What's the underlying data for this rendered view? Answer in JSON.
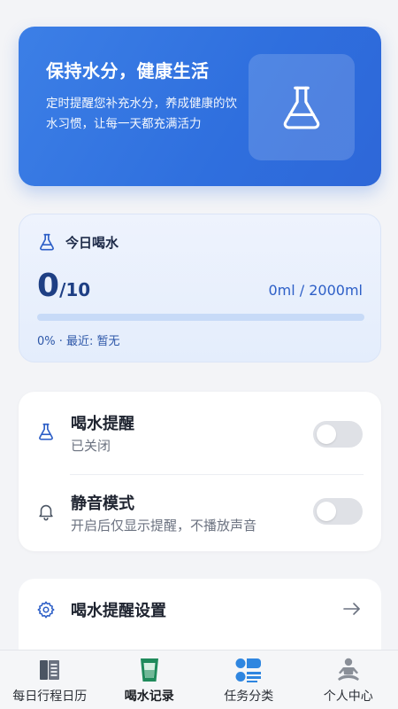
{
  "hero": {
    "title": "保持水分，健康生活",
    "description": "定时提醒您补充水分，养成健康的饮水习惯，让每一天都充满活力",
    "icon": "flask-icon"
  },
  "today": {
    "title": "今日喝水",
    "count": "0",
    "goal": "/10",
    "volume": "0ml / 2000ml",
    "progress_percent": 0,
    "status": "0% · 最近: 暂无"
  },
  "toggles": [
    {
      "title": "喝水提醒",
      "subtitle": "已关闭",
      "icon": "flask-icon",
      "enabled": false
    },
    {
      "title": "静音模式",
      "subtitle": "开启后仅显示提醒，不播放声音",
      "icon": "bell-icon",
      "enabled": false
    }
  ],
  "settings": {
    "label": "喝水提醒设置",
    "icon": "gear-icon",
    "arrow": "arrow-right-icon"
  },
  "tabs": [
    {
      "label": "每日行程日历",
      "icon": "calendar-book-icon",
      "active": false
    },
    {
      "label": "喝水记录",
      "icon": "cup-icon",
      "active": true
    },
    {
      "label": "任务分类",
      "icon": "category-icon",
      "active": false
    },
    {
      "label": "个人中心",
      "icon": "person-icon",
      "active": false
    }
  ],
  "colors": {
    "primary": "#3c7fe6",
    "primary_dark": "#1e3f84",
    "active_tab_green": "#1f8a5b",
    "tab_blue": "#2f86e0",
    "switch_off": "#dfe1e6"
  }
}
